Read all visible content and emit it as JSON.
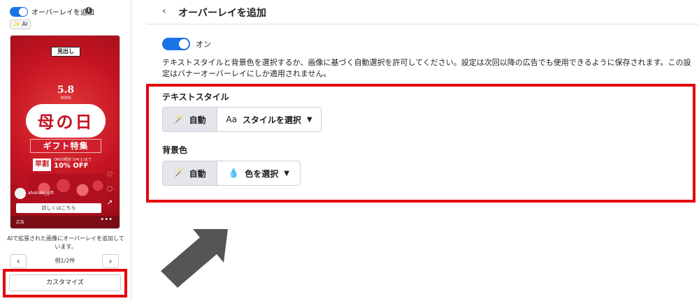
{
  "left": {
    "overlay_toggle_label": "オーバーレイを追加",
    "info_icon": "i",
    "ai_badge": "✨ AI",
    "preview": {
      "heading_chip": "見出し",
      "date": "5.8",
      "date_sub": "0000",
      "title": "母の日",
      "gift_banner": "ギフト特集",
      "early_badge": "早割",
      "discount_note": "OROO限定 5/4(土)まで",
      "discount": "10% OFF",
      "account_name": "ahahahi_gift",
      "cta": "詳しくはこちら",
      "ad_label": "広告",
      "more_icon": "•••"
    },
    "caption": "AIで拡張された画像にオーバーレイを追加しています。",
    "prev_icon": "‹",
    "next_icon": "›",
    "example_count": "例1/2件",
    "customize_label": "カスタマイズ"
  },
  "right": {
    "back_icon": "‹",
    "title": "オーバーレイを追加",
    "toggle_state": "オン",
    "description": "テキストスタイルと背景色を選択するか、画像に基づく自動選択を許可してください。設定は次回以降の広告でも使用できるように保存されます。この設定はバナーオーバーレイにしか適用されません。",
    "text_style": {
      "label": "テキストスタイル",
      "auto_label": "自動",
      "aa_icon": "Aa",
      "select_label": "スタイルを選択"
    },
    "bg_color": {
      "label": "背景色",
      "auto_label": "自動",
      "select_label": "色を選択"
    }
  },
  "colors": {
    "toggle_on": "#1b74e4",
    "highlight": "#e8000b",
    "arrow": "#555555"
  }
}
